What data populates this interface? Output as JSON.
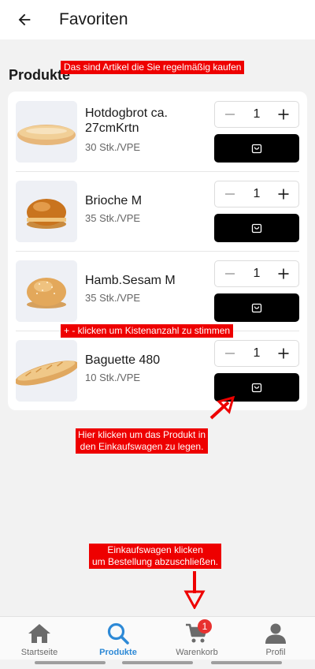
{
  "header": {
    "title": "Favoriten"
  },
  "section": {
    "title": "Produkte"
  },
  "products": [
    {
      "name": "Hotdogbrot ca. 27cmKrtn",
      "unit": "30 Stk./VPE",
      "quantity": "1"
    },
    {
      "name": "Brioche M",
      "unit": "35 Stk./VPE",
      "quantity": "1"
    },
    {
      "name": "Hamb.Sesam M",
      "unit": "35 Stk./VPE",
      "quantity": "1"
    },
    {
      "name": "Baguette 480",
      "unit": "10 Stk./VPE",
      "quantity": "1"
    }
  ],
  "annotations": {
    "favorites_note": "Das sind Artikel die Sie regelmäßig kaufen",
    "stepper_note": "+ - klicken um Kistenanzahl zu stimmen",
    "add_to_cart_note_line1": "Hier klicken um das Produkt in",
    "add_to_cart_note_line2": "den Einkaufswagen zu legen.",
    "checkout_note_line1": "Einkaufswagen klicken",
    "checkout_note_line2": "um Bestellung abzuschließen."
  },
  "bottom_nav": {
    "items": [
      {
        "label": "Startseite",
        "icon": "home-icon"
      },
      {
        "label": "Produkte",
        "icon": "search-icon",
        "active": true
      },
      {
        "label": "Warenkorb",
        "icon": "cart-icon",
        "badge": "1"
      },
      {
        "label": "Profil",
        "icon": "profile-icon"
      }
    ]
  },
  "colors": {
    "accent": "#2d89d6",
    "annotation": "#ee0000",
    "badge": "#e8312f",
    "cart_button": "#000000"
  }
}
